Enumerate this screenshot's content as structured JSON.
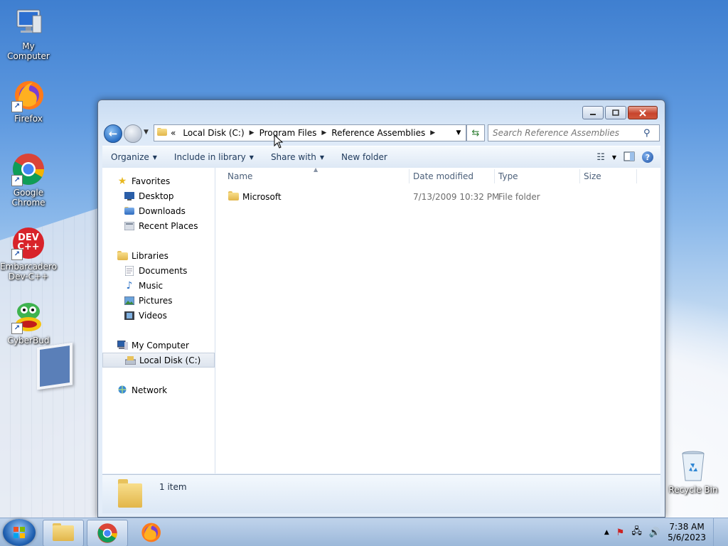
{
  "desktop": {
    "icons": [
      {
        "label": "My Computer"
      },
      {
        "label": "Firefox"
      },
      {
        "label": "Google Chrome"
      },
      {
        "label": "Embarcadero Dev-C++",
        "logo_text": "DEV C++"
      },
      {
        "label": "CyberBud"
      },
      {
        "label": "Recycle Bin"
      }
    ]
  },
  "explorer": {
    "address": {
      "overflow": "«",
      "crumbs": [
        "Local Disk (C:)",
        "Program Files",
        "Reference Assemblies"
      ]
    },
    "search_placeholder": "Search Reference Assemblies",
    "toolbar": {
      "organize": "Organize",
      "include_in_library": "Include in library",
      "share_with": "Share with",
      "new_folder": "New folder"
    },
    "nav": {
      "favorites": "Favorites",
      "desktop": "Desktop",
      "downloads": "Downloads",
      "recent_places": "Recent Places",
      "libraries": "Libraries",
      "documents": "Documents",
      "music": "Music",
      "pictures": "Pictures",
      "videos": "Videos",
      "my_computer": "My Computer",
      "local_disk": "Local Disk (C:)",
      "network": "Network"
    },
    "columns": {
      "name": "Name",
      "date_modified": "Date modified",
      "type": "Type",
      "size": "Size"
    },
    "files": [
      {
        "name": "Microsoft",
        "date_modified": "7/13/2009 10:32 PM",
        "type": "File folder",
        "size": ""
      }
    ],
    "details": {
      "item_count": "1 item"
    }
  },
  "taskbar": {
    "clock_time": "7:38 AM",
    "clock_date": "5/6/2023"
  }
}
